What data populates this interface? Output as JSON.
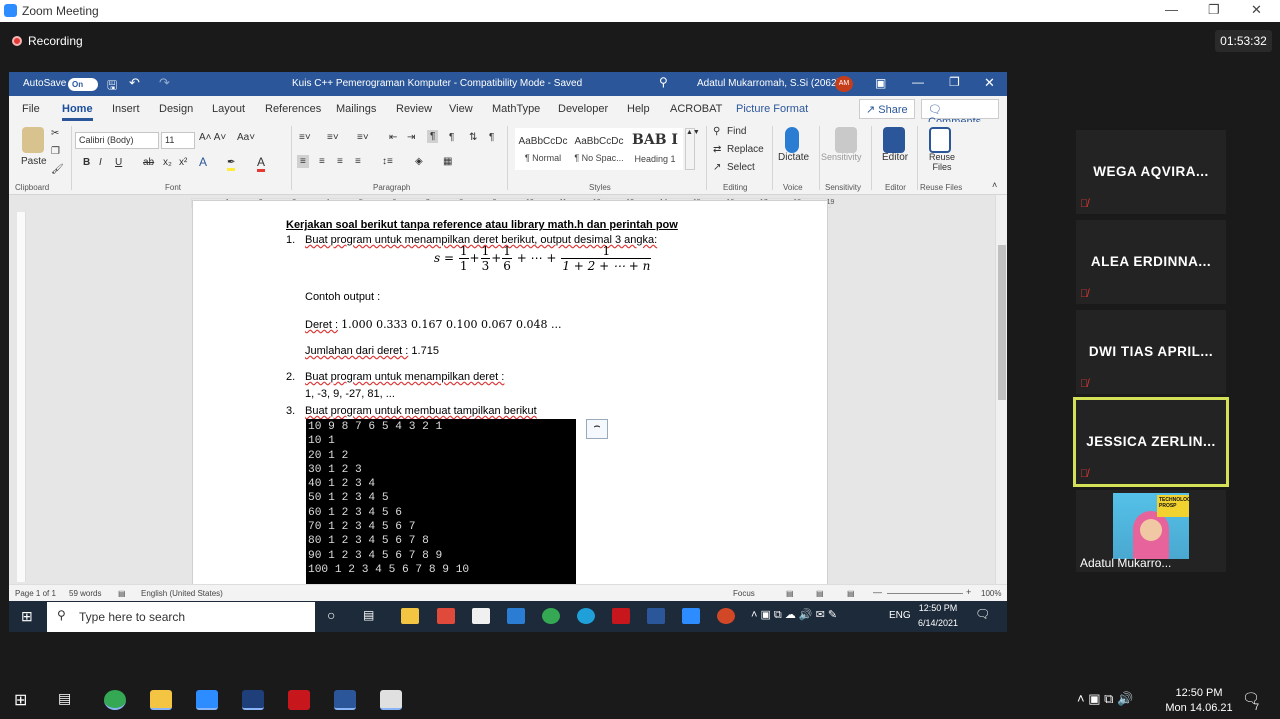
{
  "zoom": {
    "title": "Zoom Meeting",
    "recording_label": "Recording",
    "timer": "01:53:32"
  },
  "word": {
    "autosave_label": "AutoSave",
    "autosave_state": "On",
    "doc_title": "Kuis C++ Pemerograman Komputer  -  Compatibility Mode  -  Saved",
    "user": "Adatul Mukarromah, S.Si (2062)",
    "user_initials": "AM",
    "menu": [
      "File",
      "Home",
      "Insert",
      "Design",
      "Layout",
      "References",
      "Mailings",
      "Review",
      "View",
      "MathType",
      "Developer",
      "Help",
      "ACROBAT",
      "Picture Format"
    ],
    "share_label": "Share",
    "comments_label": "Comments",
    "ribbon": {
      "paste": "Paste",
      "font_name": "Calibri (Body)",
      "font_size": "11",
      "styles": [
        {
          "preview": "AaBbCcDc",
          "name": "¶ Normal"
        },
        {
          "preview": "AaBbCcDc",
          "name": "¶ No Spac..."
        },
        {
          "preview": "BAB I",
          "name": "Heading 1"
        }
      ],
      "find": "Find",
      "replace": "Replace",
      "select": "Select",
      "dictate": "Dictate",
      "sensitivity": "Sensitivity",
      "editor": "Editor",
      "reuse_files": "Reuse Files",
      "groups": [
        "Clipboard",
        "Font",
        "Paragraph",
        "Styles",
        "Editing",
        "Voice",
        "Sensitivity",
        "Editor",
        "Reuse Files"
      ]
    },
    "document": {
      "heading": "Kerjakan soal berikut tanpa reference atau library math.h dan perintah pow",
      "q1": "Buat program untuk menampilkan deret berikut, output desimal 3 angka:",
      "q1_num": "1.",
      "formula": {
        "lhs": "s =",
        "fracs": [
          [
            "1",
            "1"
          ],
          [
            "1",
            "3"
          ],
          [
            "1",
            "6"
          ]
        ],
        "mid": "+ ⋯ +",
        "last_num": "1",
        "last_den": "1 + 2 + ⋯ + n"
      },
      "contoh": "Contoh output :",
      "deret_label": "Deret :",
      "deret_value": "1.000 0.333 0.167 0.100 0.067 0.048 ...",
      "jumlah_label": "Jumlahan dari deret :",
      "jumlah_value": "1.715",
      "q2_num": "2.",
      "q2": "Buat program untuk menampilkan deret :",
      "q2_series": "1, -3, 9, -27, 81, ...",
      "q3_num": "3.",
      "q3": "Buat program untuk membuat tampilkan berikut",
      "console_lines": [
        "10 9 8 7 6 5 4 3 2 1",
        "10 1",
        "20 1 2",
        "30 1 2 3",
        "40 1 2 3 4",
        "50 1 2 3 4 5",
        "60 1 2 3 4 5 6",
        "70 1 2 3 4 5 6 7",
        "80 1 2 3 4 5 6 7 8",
        "90 1 2 3 4 5 6 7 8 9",
        "100 1 2 3 4 5 6 7 8 9 10"
      ]
    },
    "status": {
      "page": "Page 1 of 1",
      "words": "59 words",
      "language": "English (United States)",
      "focus": "Focus",
      "zoom": "100%"
    }
  },
  "inner_taskbar": {
    "search_placeholder": "Type here to search",
    "lang": "ENG",
    "time": "12:50 PM",
    "date": "6/14/2021"
  },
  "participants": [
    {
      "name": "WEGA AQVIRA..."
    },
    {
      "name": "ALEA ERDINNA..."
    },
    {
      "name": "DWI TIAS APRIL..."
    },
    {
      "name": "JESSICA ZERLIN..."
    }
  ],
  "video_participant": {
    "name": "Adatul Mukarro...",
    "banner": "TECHNOLOGY PROSP"
  },
  "taskbar": {
    "time": "12:50 PM",
    "date": "Mon 14.06.21",
    "notifications": "7"
  }
}
